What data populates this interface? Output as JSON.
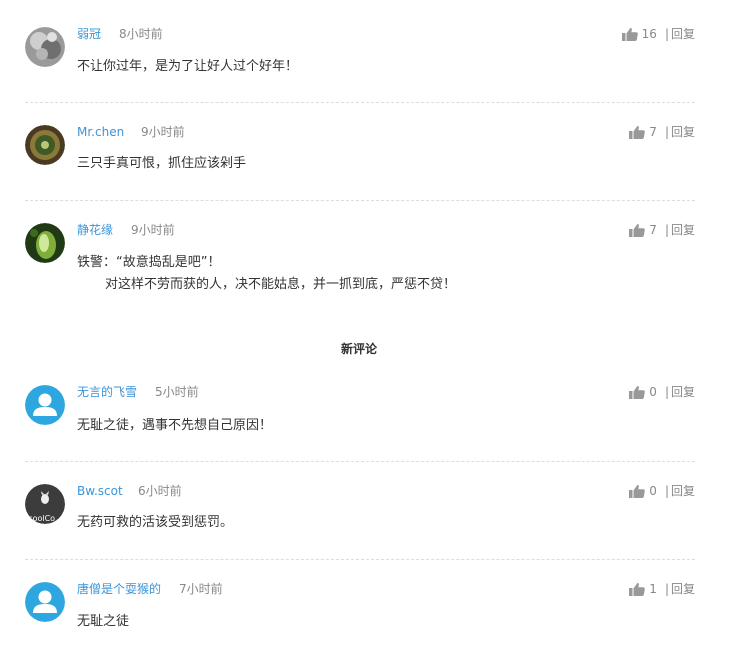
{
  "hot_comments": [
    {
      "user": "弱冠",
      "time": "8小时前",
      "likes": "16",
      "separator": "|",
      "reply": "回复",
      "text": "不让你过年，是为了让好人过个好年！"
    },
    {
      "user": "Mr.chen",
      "time": "9小时前",
      "likes": "7",
      "separator": "|",
      "reply": "回复",
      "text": "三只手真可恨，抓住应该剁手"
    },
    {
      "user": "静花缘",
      "time": "9小时前",
      "likes": "7",
      "separator": "|",
      "reply": "回复",
      "text": "铁警：“故意捣乱是吧”！",
      "text_line2": "对这样不劳而获的人，决不能姑息，并一抓到底，严惩不贷！"
    }
  ],
  "section_title": "新评论",
  "new_comments": [
    {
      "user": "无言的飞雪",
      "time": "5小时前",
      "likes": "0",
      "separator": "|",
      "reply": "回复",
      "text": "无耻之徒，遇事不先想自己原因！"
    },
    {
      "user": "Bw.scot",
      "time": "6小时前",
      "likes": "0",
      "separator": "|",
      "reply": "回复",
      "text": "无药可救的活该受到惩罚。",
      "avatar_text": "scoolCo"
    },
    {
      "user": "唐僧是个耍猴的",
      "time": "7小时前",
      "likes": "1",
      "separator": "|",
      "reply": "回复",
      "text": "无耻之徒"
    }
  ],
  "colors": {
    "username": "#3a95d8",
    "meta": "#888888",
    "text": "#333333",
    "default_avatar": "#2ea7e0",
    "divider": "#dddddd"
  },
  "icons": {
    "like": "thumbs-up-icon",
    "default_avatar": "user-silhouette-icon"
  }
}
